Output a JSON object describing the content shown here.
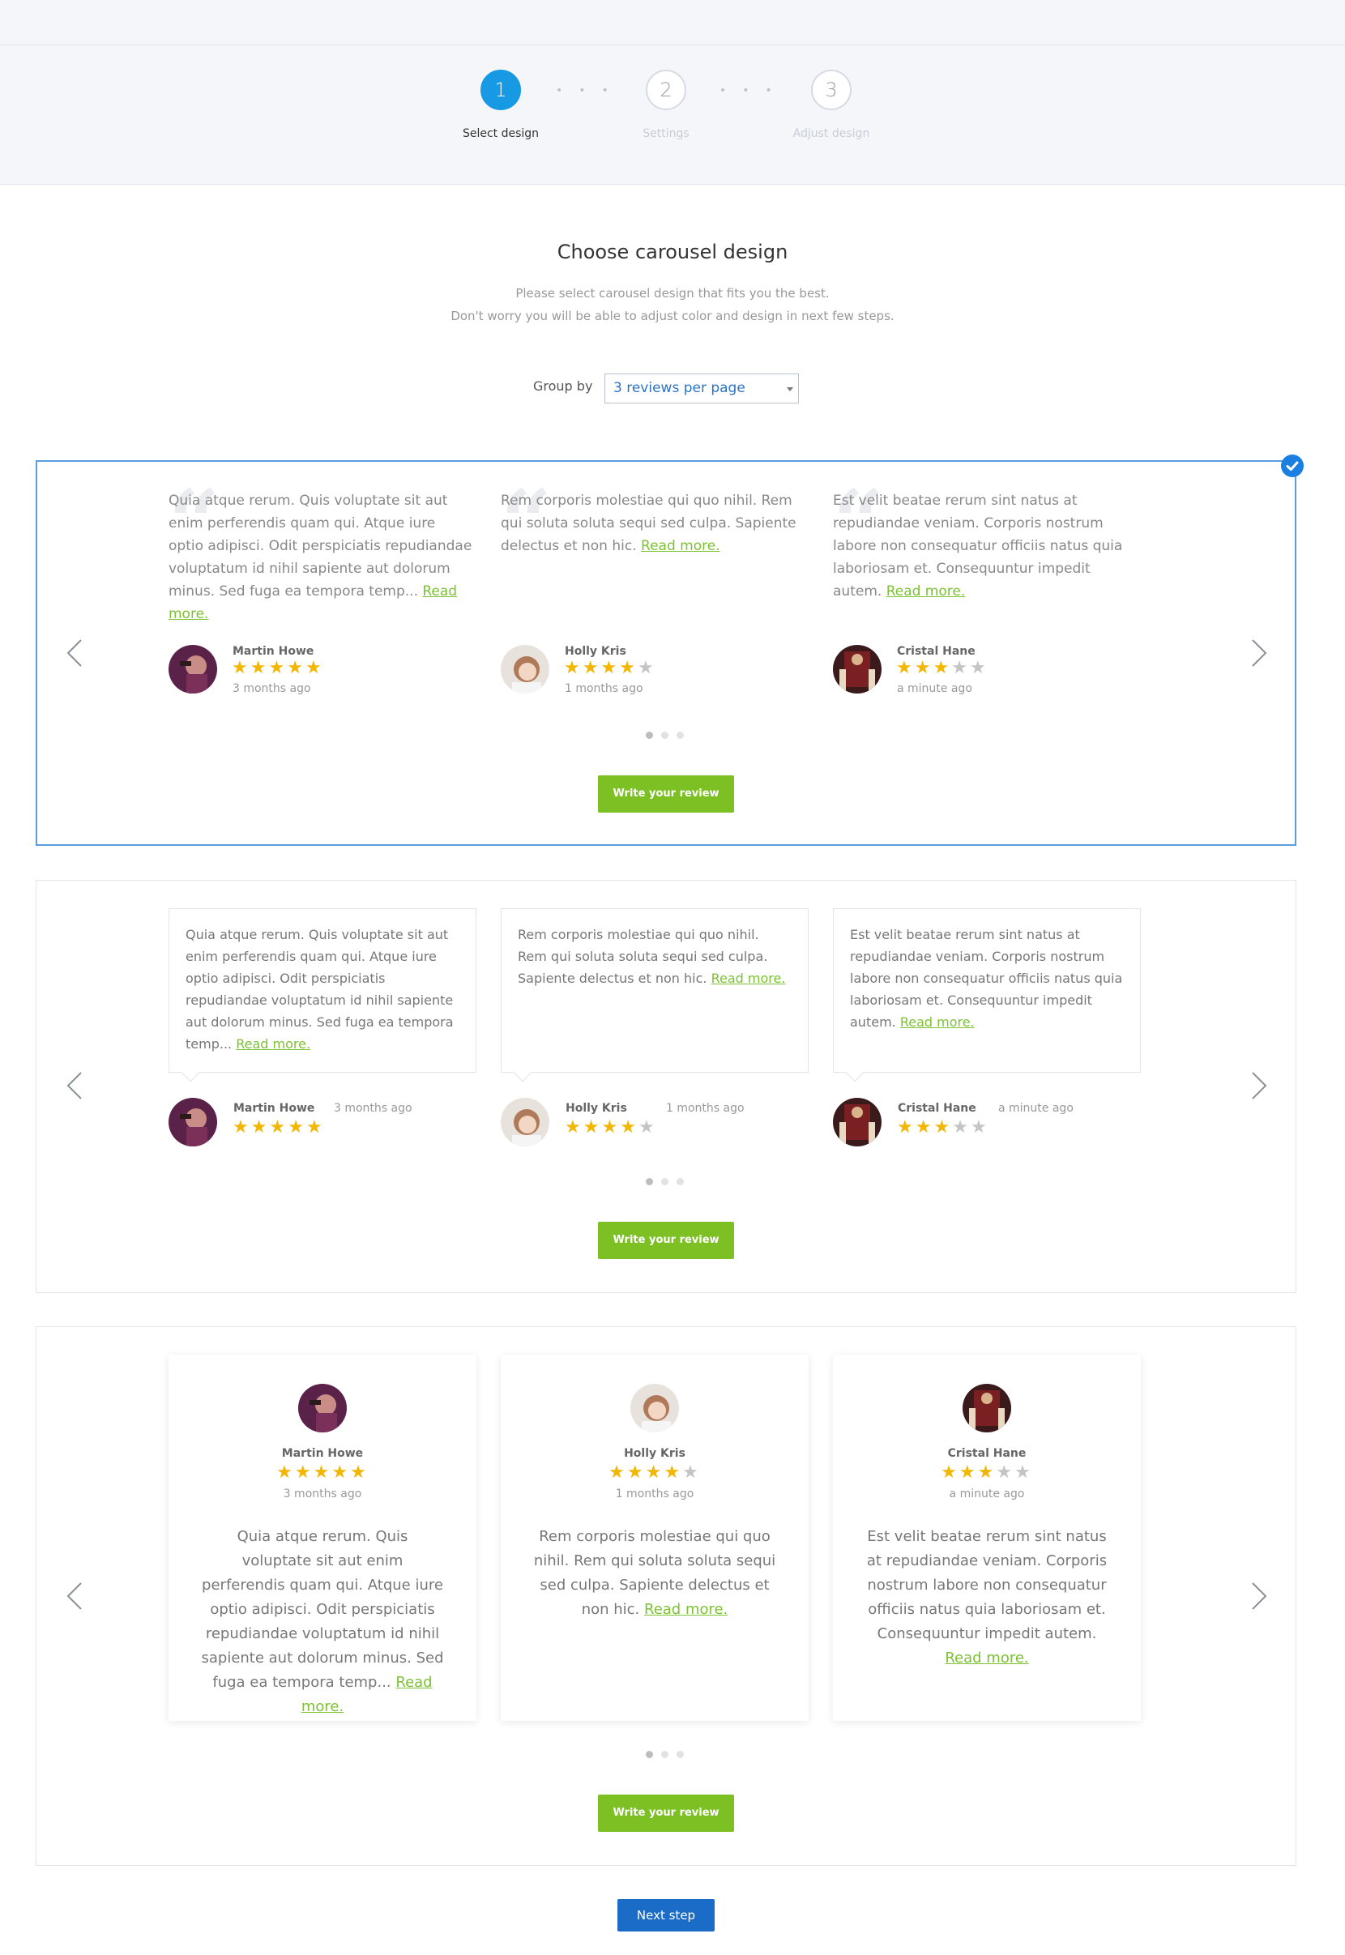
{
  "steps": [
    {
      "number": "1",
      "label": "Select design"
    },
    {
      "number": "2",
      "label": "Settings"
    },
    {
      "number": "3",
      "label": "Adjust design"
    }
  ],
  "header": {
    "title": "Choose carousel design",
    "subtitle_line1": "Please select carousel design that fits you the best.",
    "subtitle_line2": "Don't worry you will be able to adjust color and design in next few steps."
  },
  "group_by": {
    "label": "Group by",
    "value": "3 reviews per page"
  },
  "reviews": [
    {
      "name": "Martin Howe",
      "time": "3 months ago",
      "rating": 5,
      "text": "Quia atque rerum. Quis voluptate sit aut enim perferendis quam qui. Atque iure optio adipisci. Odit perspiciatis repudiandae voluptatum id nihil sapiente aut dolorum minus. Sed fuga ea tempora temp...",
      "read_more": "Read more."
    },
    {
      "name": "Holly Kris",
      "time": "1 months ago",
      "rating": 4,
      "text": "Rem corporis molestiae qui quo nihil. Rem qui soluta soluta sequi sed culpa. Sapiente delectus et non hic.",
      "read_more": "Read more."
    },
    {
      "name": "Cristal Hane",
      "time": "a minute ago",
      "rating": 3,
      "text": "Est velit beatae rerum sint natus at repudiandae veniam. Corporis nostrum labore non consequatur officiis natus quia laboriosam et. Consequuntur impedit autem.",
      "read_more": "Read more."
    }
  ],
  "write_review_label": "Write your review",
  "next_step_label": "Next step",
  "colors": {
    "accent_blue": "#1799e4",
    "green": "#7cc024",
    "star": "#f2b705",
    "button_blue": "#1a6cc7"
  }
}
